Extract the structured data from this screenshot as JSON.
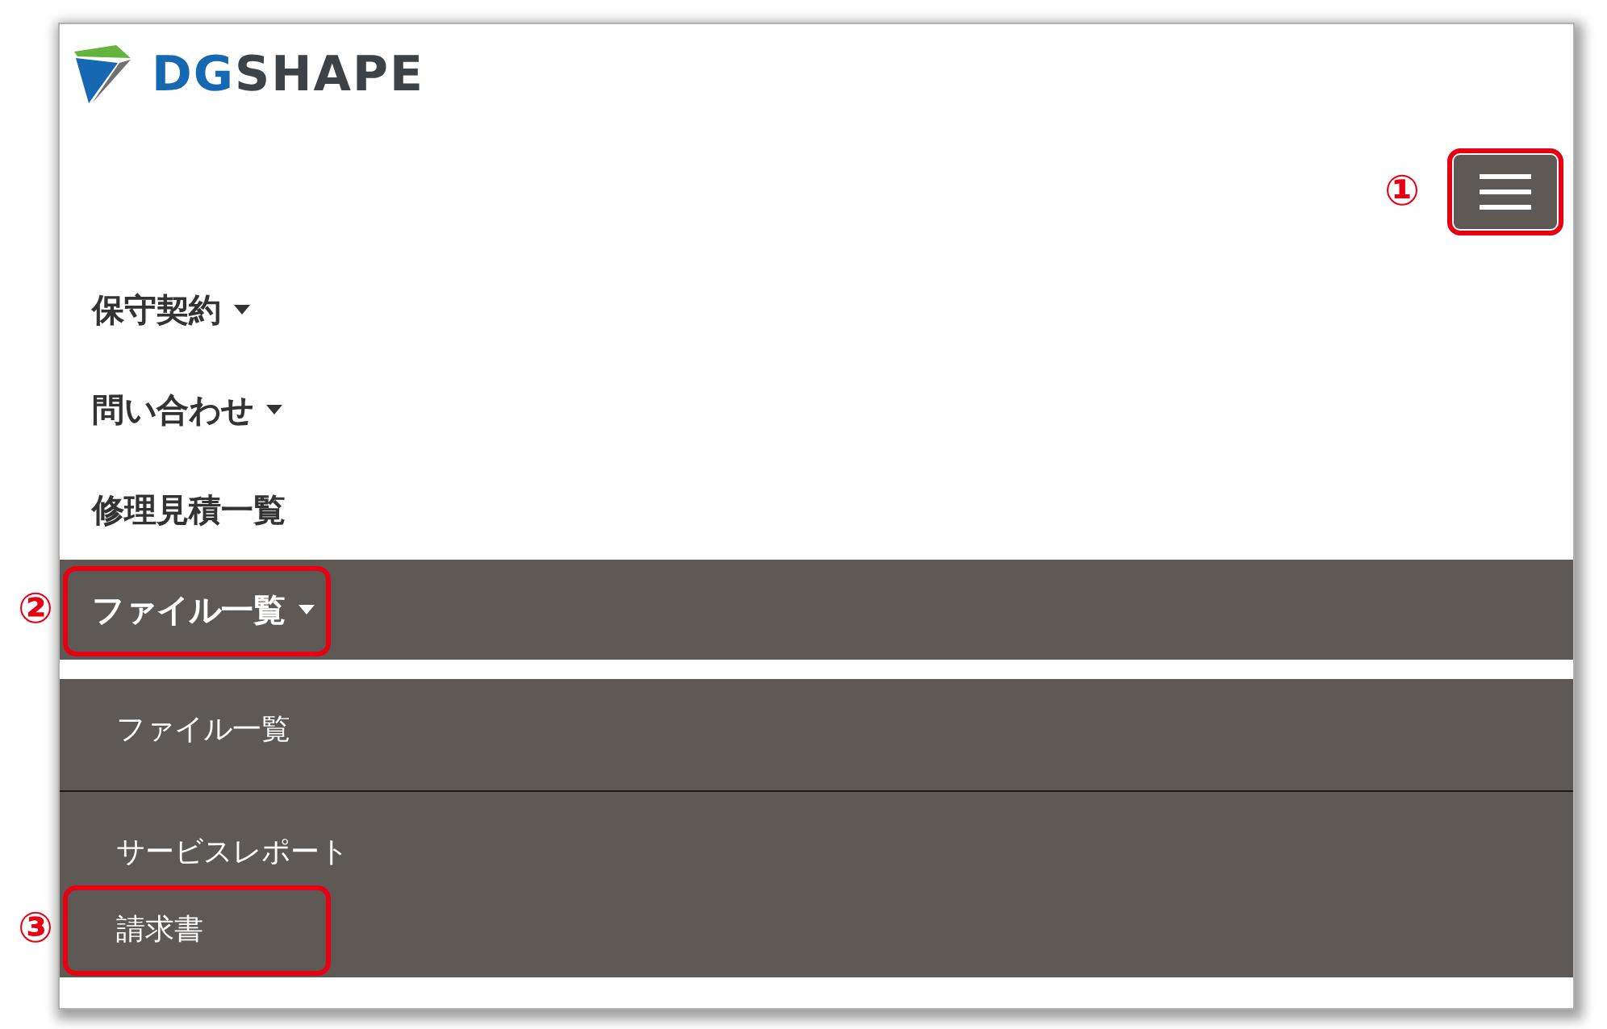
{
  "header": {
    "logo": {
      "wordmark": {
        "accent": "DG",
        "rest": "SHAPE"
      }
    },
    "menu_button": {
      "callout": "①"
    }
  },
  "nav": {
    "items": [
      {
        "label": "保守契約",
        "has_dropdown": true,
        "selected": false
      },
      {
        "label": "問い合わせ",
        "has_dropdown": true,
        "selected": false
      },
      {
        "label": "修理見積一覧",
        "has_dropdown": false,
        "selected": false
      },
      {
        "label": "ファイル一覧",
        "has_dropdown": true,
        "selected": true,
        "callout": "②",
        "children": [
          {
            "label": "ファイル一覧",
            "divider_after": true
          },
          {
            "label": "サービスレポート",
            "divider_after": false
          },
          {
            "label": "請求書",
            "divider_after": false,
            "callout": "③"
          }
        ]
      }
    ]
  }
}
